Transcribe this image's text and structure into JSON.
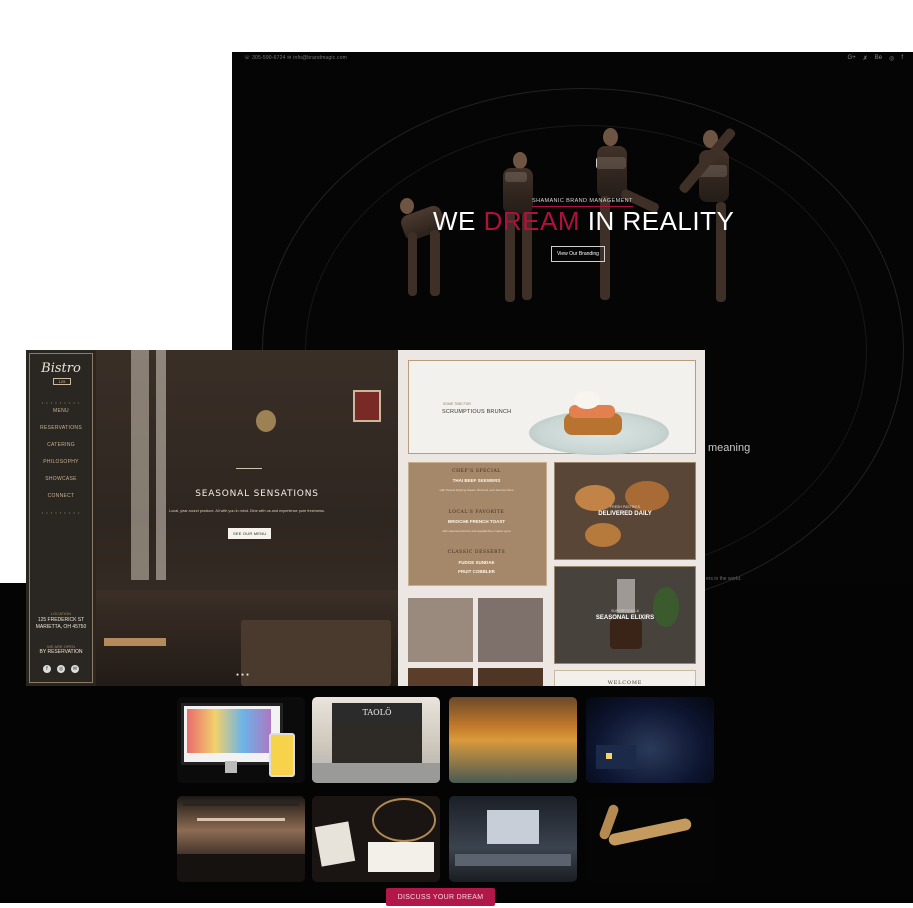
{
  "hero": {
    "contact": "☏ 305-590-6724   ✉ info@brandmagic.com",
    "social_icons": [
      "G+",
      "✗",
      "Be",
      "◎",
      "f"
    ],
    "eyebrow": "SHAMANIC BRAND MANAGEMENT",
    "headline_pre": "WE ",
    "headline_accent": "DREAM",
    "headline_post": " IN REALITY",
    "cta_label": "View Our Branding",
    "meaning_text": "meaning",
    "world_text": "ers in the world."
  },
  "bistro": {
    "logo": "Bistro",
    "logo_sub": "125",
    "nav_items": [
      "MENU",
      "RESERVATIONS",
      "CATERING",
      "PHILOSOPHY",
      "SHOWCASE",
      "CONNECT"
    ],
    "location_label": "LOCATION",
    "address_line1": "125 FREDERICK ST",
    "address_line2": "MARIETTA, OH 45750",
    "open_label": "WE ARE OPEN",
    "hours": "BY RESERVATION",
    "social_icons": [
      "f",
      "◎",
      "✉"
    ],
    "hero_title": "SEASONAL SENSATIONS",
    "hero_subtitle": "Local, year-round produce. All with you in mind. Dine with us and experience pure freshness.",
    "hero_cta": "SEE OUR MENU",
    "slider_dots": "●●●",
    "brunch_eyebrow": "SOME TIME FOR",
    "brunch_title": "SCRUMPTIOUS BRUNCH",
    "specials": [
      {
        "heading": "CHEF'S SPECIAL",
        "item": "THAI BEEF SKEWERS",
        "desc": "with Peanut Dipping Sauce, Broccoli, and Jasmine Rice"
      },
      {
        "heading": "LOCAL'S FAVORITE",
        "item": "BRIOCHE FRENCH TOAST",
        "desc": "with seasonal berries and Appalachian maple syrup"
      },
      {
        "heading": "CLASSIC DESSERTS",
        "item": "FUDGE SUNDAE",
        "item2": "FRUIT COBBLER"
      }
    ],
    "pastries_eyebrow": "FRESH PASTRIES",
    "pastries_title": "DELIVERED DAILY",
    "elixirs_eyebrow": "SUPERFOODS &",
    "elixirs_title": "SEASONAL ELIXIRS",
    "welcome": "WELCOME"
  },
  "portfolio": {
    "thumb_2_sign": "TAOLÖ",
    "cta_label": "DISCUSS YOUR DREAM"
  },
  "colors": {
    "accent": "#b0103d",
    "button": "#b2174a",
    "bistro_tan": "#a58769"
  }
}
